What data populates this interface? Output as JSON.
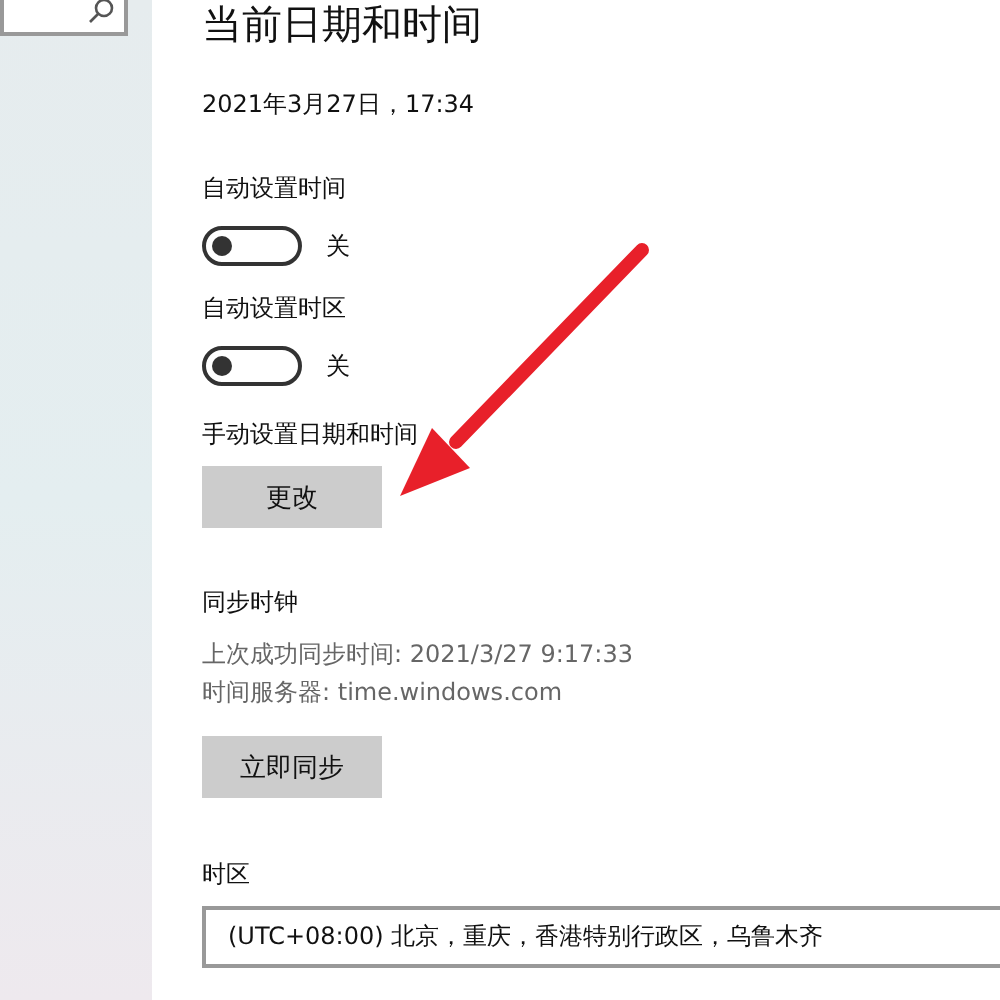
{
  "title": "当前日期和时间",
  "current_datetime": "2021年3月27日，17:34",
  "toggles": [
    {
      "label": "自动设置时间",
      "on": false,
      "state_text": "关"
    },
    {
      "label": "自动设置时区",
      "on": false,
      "state_text": "关"
    }
  ],
  "manual": {
    "label": "手动设置日期和时间",
    "button": "更改"
  },
  "sync": {
    "heading": "同步时钟",
    "lines": [
      "上次成功同步时间: 2021/3/27 9:17:33",
      "时间服务器: time.windows.com"
    ],
    "button": "立即同步"
  },
  "timezone": {
    "label": "时区",
    "value": "(UTC+08:00) 北京，重庆，香港特别行政区，乌鲁木齐"
  }
}
